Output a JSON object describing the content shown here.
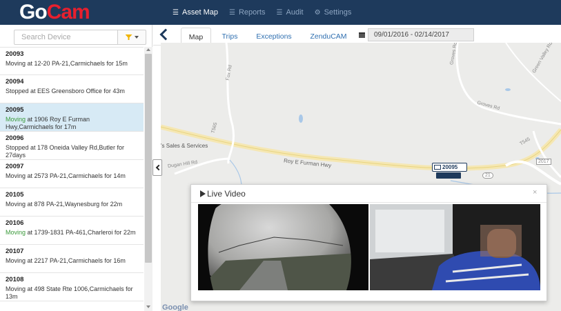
{
  "header": {
    "logo_go": "Go",
    "logo_cam": "Cam",
    "nav": [
      {
        "label": "Asset Map",
        "icon": "list-icon",
        "active": true
      },
      {
        "label": "Reports",
        "icon": "list-icon",
        "active": false
      },
      {
        "label": "Audit",
        "icon": "list-icon",
        "active": false
      },
      {
        "label": "Settings",
        "icon": "gear-icon",
        "active": false
      }
    ]
  },
  "sidebar": {
    "search_placeholder": "Search Device",
    "devices": [
      {
        "id": "20093",
        "status_prefix": "Moving",
        "status_rest": " at 12-20 PA-21,Carmichaels for 15m",
        "selected": false,
        "green": false
      },
      {
        "id": "20094",
        "status_prefix": "Stopped",
        "status_rest": " at EES Greensboro Office for 43m",
        "selected": false,
        "green": false
      },
      {
        "id": "20095",
        "status_prefix": "Moving",
        "status_rest": " at 1906 Roy E Furman Hwy,Carmichaels for 17m",
        "selected": true,
        "green": true
      },
      {
        "id": "20096",
        "status_prefix": "Stopped",
        "status_rest": " at 178 Oneida Valley Rd,Butler for 27days",
        "selected": false,
        "green": false
      },
      {
        "id": "20097",
        "status_prefix": "Moving",
        "status_rest": " at 2573 PA-21,Carmichaels for 14m",
        "selected": false,
        "green": false
      },
      {
        "id": "20105",
        "status_prefix": "Moving",
        "status_rest": " at 878 PA-21,Waynesburg for 22m",
        "selected": false,
        "green": false
      },
      {
        "id": "20106",
        "status_prefix": "Moving",
        "status_rest": " at 1739-1831 PA-461,Charleroi for 22m",
        "selected": false,
        "green": true
      },
      {
        "id": "20107",
        "status_prefix": "Moving",
        "status_rest": " at 2217 PA-21,Carmichaels for 16m",
        "selected": false,
        "green": false
      },
      {
        "id": "20108",
        "status_prefix": "Moving",
        "status_rest": " at 498 State Rte 1006,Carmichaels for 13m",
        "selected": false,
        "green": false
      }
    ]
  },
  "tabs": {
    "items": [
      {
        "label": "Map",
        "active": true
      },
      {
        "label": "Trips",
        "active": false
      },
      {
        "label": "Exceptions",
        "active": false
      },
      {
        "label": "ZenduCAM",
        "active": false
      }
    ],
    "date_range": "09/01/2016 - 02/14/2017"
  },
  "map": {
    "labels": [
      "'s Sales & Services",
      "Dugan Hill Rd",
      "Roy E Furman Hwy",
      "Groves Rd",
      "Fox Rd",
      "Green Valley Rd",
      "Groves Rd",
      "T545",
      "T565",
      "2017",
      "21"
    ],
    "pin_label": "20095",
    "provider": "Google"
  },
  "modal": {
    "title": "Live Video",
    "close": "×"
  }
}
